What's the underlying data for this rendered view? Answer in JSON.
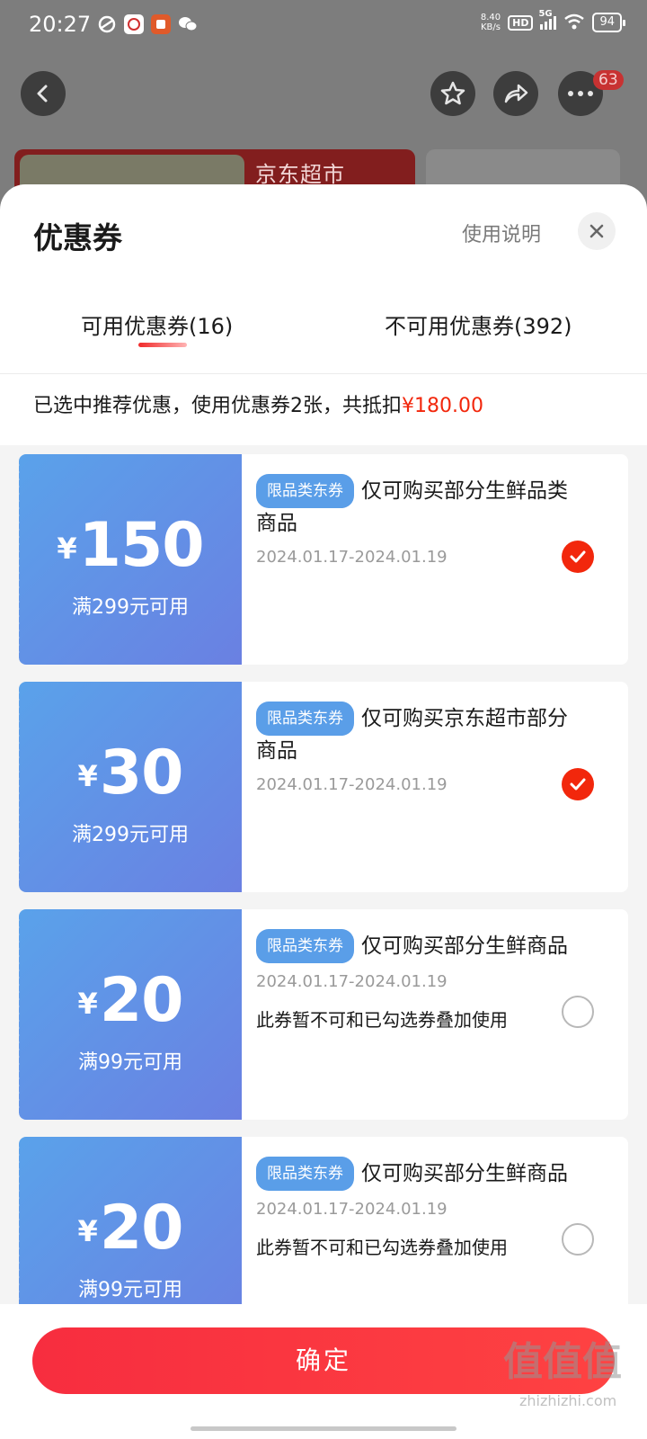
{
  "status_bar": {
    "time": "20:27",
    "net_speed_top": "8.40",
    "net_speed_bottom": "KB/s",
    "hd": "HD",
    "network": "5G",
    "battery": "94"
  },
  "background_page": {
    "cart_badge": "63",
    "banner_text": "京东超市"
  },
  "sheet": {
    "title": "优惠券",
    "help_link": "使用说明",
    "tabs": [
      {
        "label": "可用优惠券(16)",
        "active": true
      },
      {
        "label": "不可用优惠券(392)",
        "active": false
      }
    ],
    "summary_text": "已选中推荐优惠，使用优惠券2张，共抵扣",
    "summary_amount": "¥180.00"
  },
  "coupons": [
    {
      "currency": "¥",
      "amount": "150",
      "condition": "满299元可用",
      "tag": "限品类东券",
      "description": "仅可购买部分生鲜品类商品",
      "validity": "2024.01.17-2024.01.19",
      "note": "",
      "selected": true
    },
    {
      "currency": "¥",
      "amount": "30",
      "condition": "满299元可用",
      "tag": "限品类东券",
      "description": "仅可购买京东超市部分商品",
      "validity": "2024.01.17-2024.01.19",
      "note": "",
      "selected": true
    },
    {
      "currency": "¥",
      "amount": "20",
      "condition": "满99元可用",
      "tag": "限品类东券",
      "description": "仅可购买部分生鲜商品",
      "validity": "2024.01.17-2024.01.19",
      "note": "此券暂不可和已勾选券叠加使用",
      "selected": false
    },
    {
      "currency": "¥",
      "amount": "20",
      "condition": "满99元可用",
      "tag": "限品类东券",
      "description": "仅可购买部分生鲜商品",
      "validity": "2024.01.17-2024.01.19",
      "note": "此券暂不可和已勾选券叠加使用",
      "selected": false
    }
  ],
  "confirm_label": "确定",
  "watermark": {
    "logo": "值值值",
    "url": "zhizhizhi.com"
  },
  "colors": {
    "accent_red": "#f2270c",
    "coupon_blue": "#5a9ee8"
  }
}
